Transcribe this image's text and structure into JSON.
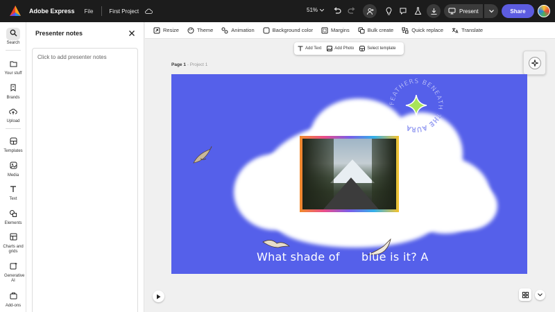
{
  "topbar": {
    "app_name": "Adobe Express",
    "file_menu": "File",
    "project_name": "First Project",
    "zoom": "51%",
    "present_label": "Present",
    "share_label": "Share"
  },
  "rail": {
    "items": [
      {
        "label": "Search",
        "icon": "search-icon"
      },
      {
        "label": "Your stuff",
        "icon": "folder-icon"
      },
      {
        "label": "Brands",
        "icon": "brand-icon"
      },
      {
        "label": "Upload",
        "icon": "upload-icon"
      },
      {
        "label": "Templates",
        "icon": "templates-icon"
      },
      {
        "label": "Media",
        "icon": "media-icon"
      },
      {
        "label": "Text",
        "icon": "text-icon"
      },
      {
        "label": "Elements",
        "icon": "elements-icon"
      },
      {
        "label": "Charts and grids",
        "icon": "charts-icon"
      },
      {
        "label": "Generative AI",
        "icon": "generative-ai-icon"
      },
      {
        "label": "Add-ons",
        "icon": "addons-icon"
      }
    ]
  },
  "notes": {
    "title": "Presenter notes",
    "placeholder": "Click to add presenter notes"
  },
  "toolbar": {
    "items": [
      {
        "label": "Resize",
        "icon": "resize-icon"
      },
      {
        "label": "Theme",
        "icon": "theme-icon"
      },
      {
        "label": "Animation",
        "icon": "animation-icon"
      },
      {
        "label": "Background color",
        "icon": "background-color-icon"
      },
      {
        "label": "Margins",
        "icon": "margins-icon"
      },
      {
        "label": "Bulk create",
        "icon": "bulk-create-icon"
      },
      {
        "label": "Quick replace",
        "icon": "quick-replace-icon"
      },
      {
        "label": "Translate",
        "icon": "translate-icon"
      }
    ]
  },
  "float_bar": {
    "add_text": "Add Text",
    "add_photo": "Add Photo",
    "select_template": "Select template"
  },
  "canvas": {
    "page_label": "Page 1",
    "page_sep": " - ",
    "page_project": "Project 1",
    "text_left": "What shade of",
    "text_right": "blue is it? A",
    "ring_text": "FEATHERS BENEATH THE AURA",
    "background_color": "#5560ea"
  }
}
